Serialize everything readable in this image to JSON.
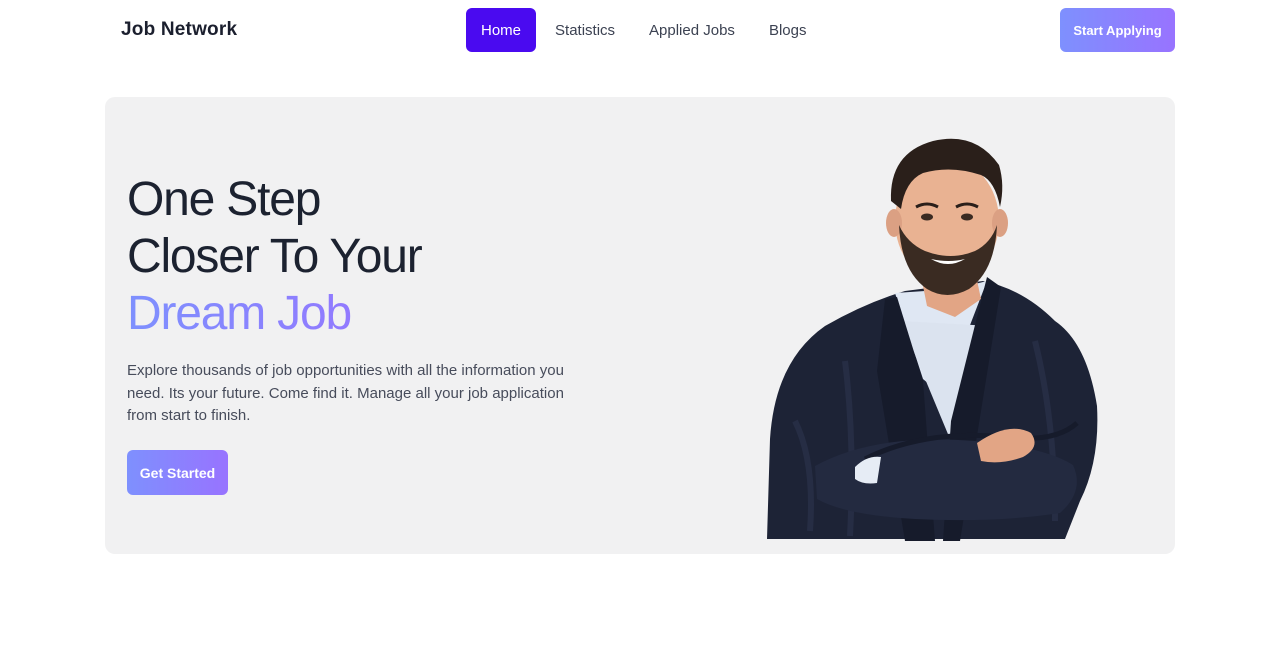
{
  "header": {
    "brand": "Job Network",
    "nav": [
      {
        "label": "Home",
        "active": true
      },
      {
        "label": "Statistics",
        "active": false
      },
      {
        "label": "Applied Jobs",
        "active": false
      },
      {
        "label": "Blogs",
        "active": false
      }
    ],
    "cta_label": "Start Applying"
  },
  "hero": {
    "title_lines": [
      "One Step",
      "Closer To Your",
      "Dream Job"
    ],
    "description": "Explore thousands of job opportunities with all the information you need. Its your future. Come find it. Manage all your job application from start to finish.",
    "button_label": "Get Started",
    "image": "smiling man with crossed arms"
  },
  "colors": {
    "accent_start": "#7E90FE",
    "accent_end": "#9873FF",
    "nav_active": "#4A0AF0",
    "hero_bg": "#F1F1F2"
  }
}
